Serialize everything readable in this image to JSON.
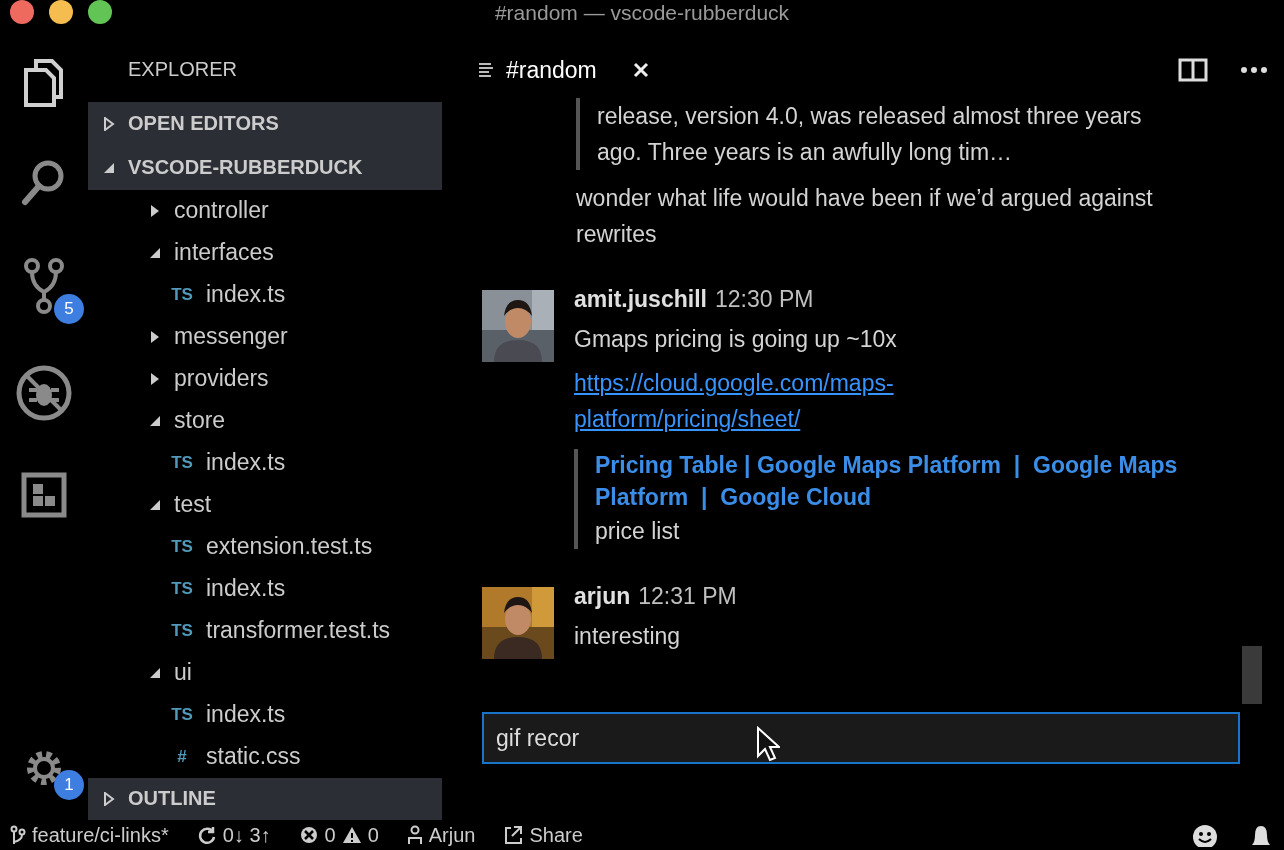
{
  "window": {
    "title": "#random — vscode-rubberduck"
  },
  "activity_bar": {
    "scm_badge": "5",
    "settings_badge": "1"
  },
  "sidebar": {
    "title": "EXPLORER",
    "sections": [
      {
        "label": "OPEN EDITORS",
        "expanded": false
      },
      {
        "label": "VSCODE-RUBBERDUCK",
        "expanded": true
      }
    ],
    "tree": [
      {
        "kind": "folder",
        "name": "controller",
        "expanded": false
      },
      {
        "kind": "folder",
        "name": "interfaces",
        "expanded": true,
        "children": [
          {
            "kind": "file",
            "icon": "TS",
            "name": "index.ts"
          }
        ]
      },
      {
        "kind": "folder",
        "name": "messenger",
        "expanded": false
      },
      {
        "kind": "folder",
        "name": "providers",
        "expanded": false
      },
      {
        "kind": "folder",
        "name": "store",
        "expanded": true,
        "children": [
          {
            "kind": "file",
            "icon": "TS",
            "name": "index.ts"
          }
        ]
      },
      {
        "kind": "folder",
        "name": "test",
        "expanded": true,
        "children": [
          {
            "kind": "file",
            "icon": "TS",
            "name": "extension.test.ts"
          },
          {
            "kind": "file",
            "icon": "TS",
            "name": "index.ts"
          },
          {
            "kind": "file",
            "icon": "TS",
            "name": "transformer.test.ts"
          }
        ]
      },
      {
        "kind": "folder",
        "name": "ui",
        "expanded": true,
        "children": [
          {
            "kind": "file",
            "icon": "TS",
            "name": "index.ts"
          },
          {
            "kind": "file",
            "icon": "#",
            "name": "static.css"
          }
        ]
      }
    ],
    "outline": {
      "label": "OUTLINE",
      "expanded": false
    }
  },
  "tabs": [
    {
      "label": "#random",
      "selected": true
    }
  ],
  "chat": {
    "items": [
      {
        "kind": "quote",
        "text": "release, version 4.0, was released almost three years ago. Three years is an awfully long tim…"
      },
      {
        "kind": "text",
        "text": "wonder what life would have been if we’d argued against rewrites"
      },
      {
        "kind": "message",
        "author": "amit.juschill",
        "time": "12:30 PM",
        "blocks": [
          {
            "kind": "text",
            "text": "Gmaps pricing is going up ~10x"
          },
          {
            "kind": "link",
            "text": "https://cloud.google.com/maps-platform/pricing/sheet/"
          },
          {
            "kind": "attachment",
            "title": "Pricing Table | Google Maps Platform  |  Google Maps Platform  |  Google Cloud",
            "text": "price list"
          }
        ]
      },
      {
        "kind": "message",
        "author": "arjun",
        "time": "12:31 PM",
        "blocks": [
          {
            "kind": "text",
            "text": "interesting"
          }
        ]
      }
    ],
    "input": {
      "value": "gif recor"
    }
  },
  "status_bar": {
    "branch": "feature/ci-links*",
    "sync": "0↓ 3↑",
    "errors": "0",
    "warnings": "0",
    "user": "Arjun",
    "share": "Share"
  }
}
